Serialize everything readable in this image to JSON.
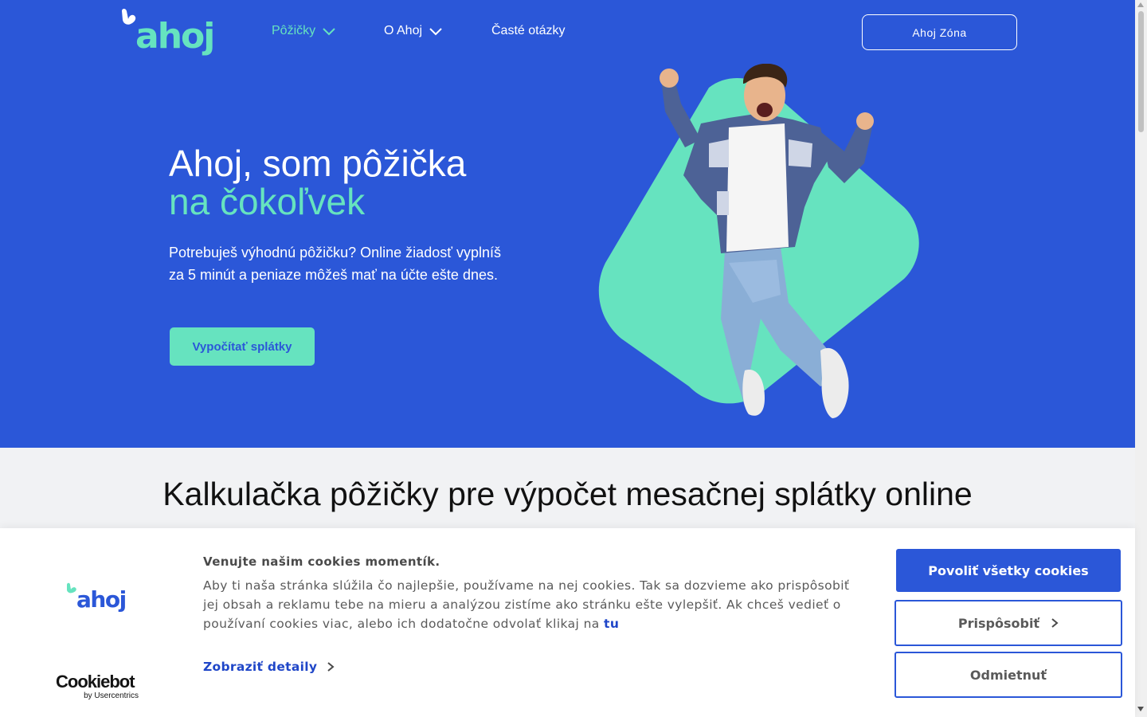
{
  "header": {
    "logo_text": "ahoj",
    "nav": [
      {
        "label": "Pôžičky",
        "active": true
      },
      {
        "label": "O Ahoj",
        "active": false
      },
      {
        "label": "Časté otázky",
        "active": false
      }
    ],
    "zone_button": "Ahoj Zóna"
  },
  "hero": {
    "title_line1": "Ahoj, som pôžička",
    "title_line2": "na čokoľvek",
    "description": "Potrebuješ výhodnú pôžičku? Online žiadosť vyplníš za 5 minút a peniaze môžeš mať na účte ešte dnes.",
    "cta": "Vypočítať splátky"
  },
  "calculator": {
    "title": "Kalkulačka pôžičky pre výpočet mesačnej splátky online"
  },
  "cookie_banner": {
    "logo_text": "ahoj",
    "heading": "Venujte našim cookies momentík.",
    "text": "Aby ti naša stránka slúžila čo najlepšie, používame na nej cookies. Tak sa dozvieme ako prispôsobiť jej obsah a reklamu tebe na mieru a analýzou zistíme ako stránku ešte vylepšiť.   Ak chceš vedieť o používaní cookies viac, alebo ich dodatočne odvolať klikaj na",
    "link": "tu",
    "details": "Zobraziť detaily",
    "allow_all": "Povoliť všetky cookies",
    "customize": "Prispôsobiť",
    "deny": "Odmietnuť",
    "provider": "Cookiebot",
    "provider_sub": "by Usercentrics"
  },
  "colors": {
    "brand_blue": "#2b57d8",
    "brand_mint": "#66e3bf",
    "link_blue": "#1f46c8"
  }
}
